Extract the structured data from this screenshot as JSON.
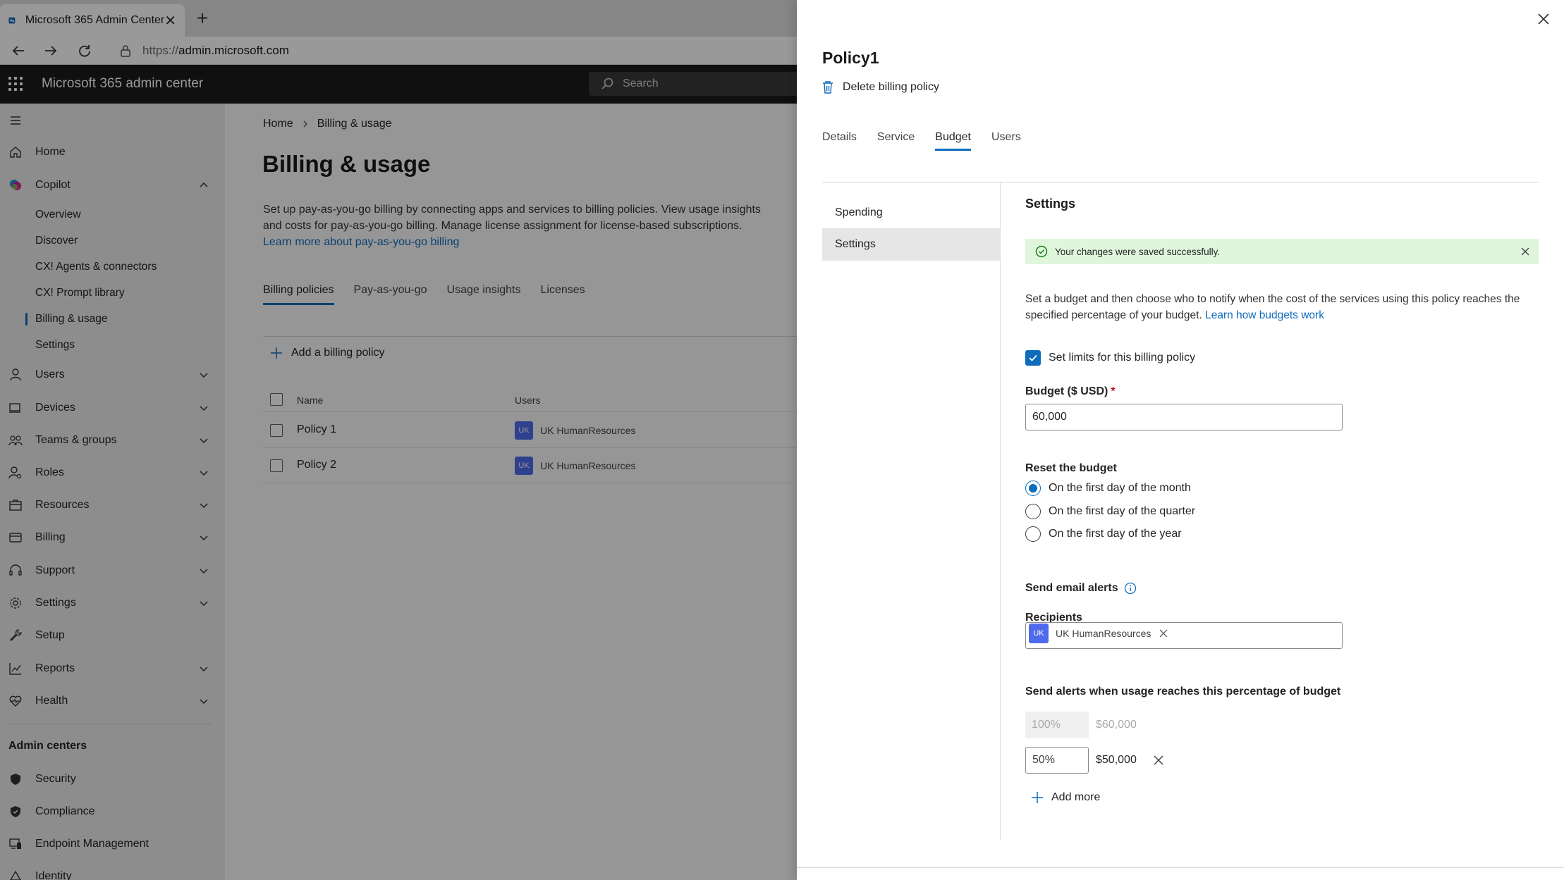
{
  "browser": {
    "tab_title": "Microsoft 365 Admin Center",
    "url_protocol": "https://",
    "url_host": "admin.microsoft.com"
  },
  "header": {
    "app_title": "Microsoft 365 admin center",
    "search_placeholder": "Search"
  },
  "sidebar": {
    "items": [
      {
        "label": "Home"
      },
      {
        "label": "Copilot"
      },
      {
        "label": "Users"
      },
      {
        "label": "Devices"
      },
      {
        "label": "Teams & groups"
      },
      {
        "label": "Roles"
      },
      {
        "label": "Resources"
      },
      {
        "label": "Billing"
      },
      {
        "label": "Support"
      },
      {
        "label": "Settings"
      },
      {
        "label": "Setup"
      },
      {
        "label": "Reports"
      },
      {
        "label": "Health"
      }
    ],
    "copilot_sub": [
      {
        "label": "Overview"
      },
      {
        "label": "Discover"
      },
      {
        "label": "CX! Agents & connectors"
      },
      {
        "label": "CX! Prompt library"
      },
      {
        "label": "Billing & usage"
      },
      {
        "label": "Settings"
      }
    ],
    "admin_centers_heading": "Admin centers",
    "admin_centers": [
      {
        "label": "Security"
      },
      {
        "label": "Compliance"
      },
      {
        "label": "Endpoint Management"
      },
      {
        "label": "Identity"
      }
    ]
  },
  "main": {
    "breadcrumb": [
      "Home",
      "Billing & usage"
    ],
    "title": "Billing & usage",
    "description": "Set up pay-as-you-go billing by connecting apps and services to billing policies. View usage insights and costs for pay-as-you-go billing. Manage license assignment for license-based subscriptions.",
    "description_link": "Learn more about pay-as-you-go billing",
    "tabs": [
      "Billing policies",
      "Pay-as-you-go",
      "Usage insights",
      "Licenses"
    ],
    "add_policy_label": "Add a billing policy",
    "table": {
      "columns": [
        "Name",
        "Users"
      ],
      "rows": [
        {
          "name": "Policy 1",
          "user_initials": "UK",
          "user": "UK HumanResources"
        },
        {
          "name": "Policy 2",
          "user_initials": "UK",
          "user": "UK HumanResources"
        }
      ]
    }
  },
  "panel": {
    "title": "Policy1",
    "delete_label": "Delete billing policy",
    "tabs": [
      "Details",
      "Service",
      "Budget",
      "Users"
    ],
    "active_tab": "Budget",
    "left_nav": [
      "Spending",
      "Settings"
    ],
    "settings": {
      "title": "Settings",
      "success_message": "Your changes were saved successfully.",
      "description": "Set a budget and then choose who to notify when the cost of the services using this policy reaches the specified percentage of your budget.",
      "description_link": "Learn how budgets work",
      "limit_checkbox_label": "Set limits for this billing policy",
      "limit_checked": true,
      "budget_label": "Budget ($ USD)",
      "budget_required_mark": "*",
      "budget_value": "60,000",
      "reset_label": "Reset the budget",
      "reset_options": [
        "On the first day of the month",
        "On the first day of the quarter",
        "On the first day of the year"
      ],
      "reset_selected": "On the first day of the month",
      "email_alerts_label": "Send email alerts",
      "recipients_label": "Recipients",
      "recipient_initials": "UK",
      "recipient_name": "UK HumanResources",
      "threshold_label": "Send alerts when usage reaches this percentage of budget",
      "thresholds": [
        {
          "percent": "100%",
          "amount": "$60,000"
        },
        {
          "percent": "50%",
          "amount": "$50,000"
        }
      ],
      "add_more_label": "Add more"
    }
  },
  "colors": {
    "accent": "#0f6cbd",
    "header_bg": "#1b1b1b",
    "success_bg": "#dff6dd",
    "success_icon": "#107c10",
    "avatar_bg": "#4f6bed"
  }
}
